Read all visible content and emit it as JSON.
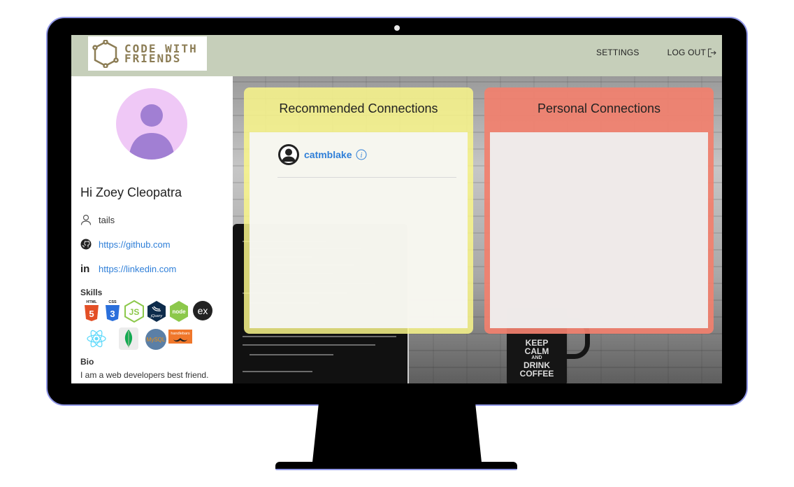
{
  "navbar": {
    "logo_line1": "CODE WITH",
    "logo_line2": "FRIENDS",
    "settings_label": "SETTINGS",
    "logout_label": "LOG OUT"
  },
  "profile": {
    "greeting": "Hi Zoey Cleopatra",
    "username": "tails",
    "github_url": "https://github.com",
    "linkedin_url": "https://linkedin.com",
    "skills_title": "Skills",
    "skills": [
      "HTML5",
      "CSS3",
      "JS",
      "jQuery",
      "node",
      "ex",
      "React",
      "MongoDB",
      "MySQL",
      "handlebars"
    ],
    "bio_title": "Bio",
    "bio_text": "I am a web developers best friend."
  },
  "skill_labels": {
    "html": "HTML",
    "css": "CSS",
    "node": "node",
    "ex": "ex",
    "mysql": "MySQL",
    "jquery": "jQuery",
    "handlebars": "handlebars"
  },
  "recommended": {
    "title": "Recommended Connections",
    "connections": [
      {
        "name": "catmblake"
      }
    ]
  },
  "personal": {
    "title": "Personal Connections",
    "connections": []
  },
  "background": {
    "mug_line1": "KEEP",
    "mug_line2": "CALM",
    "mug_line3": "AND",
    "mug_line4": "DRINK",
    "mug_line5": "COFFEE"
  },
  "colors": {
    "navbar": "#c6cfba",
    "recommended_panel": "#f9f68a",
    "personal_panel": "#f1806e",
    "link": "#2f7fd8",
    "avatar_bg": "#efc8f6"
  }
}
